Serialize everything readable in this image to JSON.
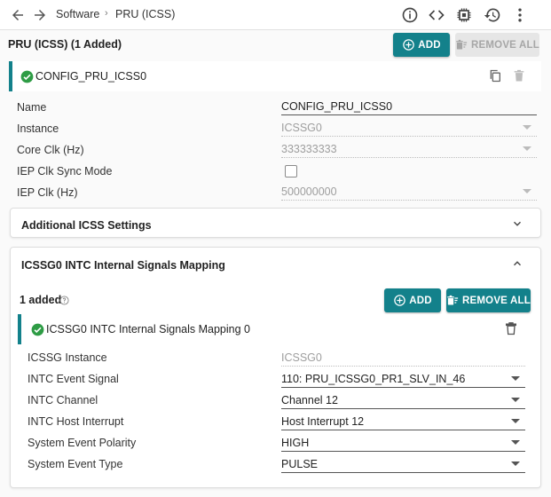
{
  "nav": {
    "breadcrumb": [
      "Software",
      "PRU (ICSS)"
    ],
    "separator": "›"
  },
  "module": {
    "title": "PRU (ICSS) (1 Added)",
    "add_label": "ADD",
    "remove_all_label": "REMOVE ALL"
  },
  "instance": {
    "name": "CONFIG_PRU_ICSS0",
    "fields": {
      "name": {
        "label": "Name",
        "value": "CONFIG_PRU_ICSS0"
      },
      "instance": {
        "label": "Instance",
        "value": "ICSSG0"
      },
      "core_clk": {
        "label": "Core Clk (Hz)",
        "value": "333333333"
      },
      "iep_sync": {
        "label": "IEP Clk Sync Mode",
        "checked": false
      },
      "iep_clk": {
        "label": "IEP Clk (Hz)",
        "value": "500000000"
      }
    }
  },
  "additional": {
    "title": "Additional ICSS Settings"
  },
  "intc": {
    "title": "ICSSG0 INTC Internal Signals Mapping",
    "added_label": "1 added",
    "add_label": "ADD",
    "remove_all_label": "REMOVE ALL",
    "item": {
      "name": "ICSSG0 INTC Internal Signals Mapping 0",
      "fields": {
        "icssg_instance": {
          "label": "ICSSG Instance",
          "value": "ICSSG0"
        },
        "event_signal": {
          "label": "INTC Event Signal",
          "value": "110: PRU_ICSSG0_PR1_SLV_IN_46"
        },
        "channel": {
          "label": "INTC Channel",
          "value": "Channel 12"
        },
        "host_interrupt": {
          "label": "INTC Host Interrupt",
          "value": "Host Interrupt 12"
        },
        "polarity": {
          "label": "System Event Polarity",
          "value": "HIGH"
        },
        "type": {
          "label": "System Event Type",
          "value": "PULSE"
        }
      }
    }
  },
  "colors": {
    "accent": "#13818b",
    "success": "#2e9c45",
    "disabled_button": "#e6e6e6"
  }
}
